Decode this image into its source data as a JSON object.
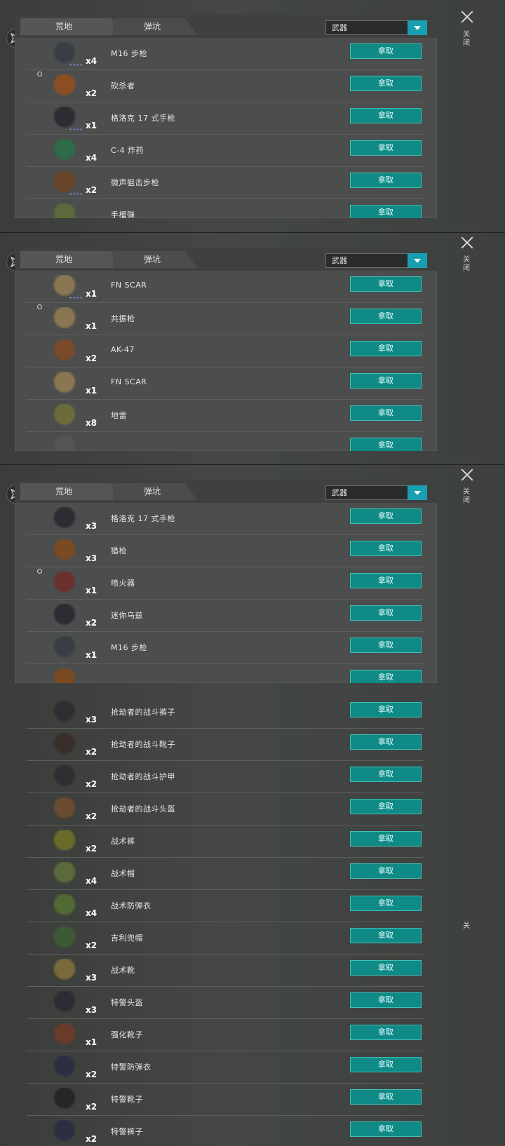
{
  "common": {
    "tab_wasteland": "荒地",
    "tab_crater": "弹坑",
    "filter_value": "武器",
    "take_label": "拿取",
    "close_label": "关闭",
    "close_label_partial": "关"
  },
  "colors": {
    "accent": "#1a9fb1",
    "take_button": "#0f8a86",
    "panel": "#4b4e4c"
  },
  "panel1": {
    "items": [
      {
        "name": "M16 步枪",
        "qty": "x4",
        "icon": "rifle-icon",
        "color": "#3a3d44",
        "dots": true,
        "badge": false
      },
      {
        "name": "砍杀者",
        "qty": "x2",
        "icon": "rocket-launcher-icon",
        "color": "#8b4e22",
        "dots": false,
        "badge": true
      },
      {
        "name": "格洛克 17 式手枪",
        "qty": "x1",
        "icon": "pistol-icon",
        "color": "#2b2d33",
        "dots": true,
        "badge": false
      },
      {
        "name": "C-4 炸药",
        "qty": "x4",
        "icon": "explosive-icon",
        "color": "#2e6b4a",
        "dots": false,
        "badge": false
      },
      {
        "name": "微声狙击步枪",
        "qty": "x2",
        "icon": "sniper-rifle-icon",
        "color": "#6a4426",
        "dots": true,
        "badge": false
      },
      {
        "name": "手榴弹",
        "qty": "",
        "icon": "grenade-icon",
        "color": "#5b6a3a",
        "dots": false,
        "badge": false
      }
    ]
  },
  "panel2": {
    "items": [
      {
        "name": "FN SCAR",
        "qty": "x1",
        "icon": "assault-rifle-icon",
        "color": "#8a7650",
        "dots": true,
        "badge": false
      },
      {
        "name": "共振枪",
        "qty": "x1",
        "icon": "resonance-gun-icon",
        "color": "#8a7650",
        "dots": false,
        "badge": true
      },
      {
        "name": "AK-47",
        "qty": "x2",
        "icon": "ak-rifle-icon",
        "color": "#7a4a2a",
        "dots": false,
        "badge": false
      },
      {
        "name": "FN SCAR",
        "qty": "x1",
        "icon": "assault-rifle-icon",
        "color": "#8a7650",
        "dots": false,
        "badge": false
      },
      {
        "name": "地雷",
        "qty": "x8",
        "icon": "landmine-icon",
        "color": "#6b6b3c",
        "dots": false,
        "badge": false
      },
      {
        "name": "",
        "qty": "",
        "icon": "weapon-icon",
        "color": "#555",
        "dots": false,
        "badge": false
      }
    ]
  },
  "panel3": {
    "items": [
      {
        "name": "格洛克 17 式手枪",
        "qty": "x3",
        "icon": "pistol-icon",
        "color": "#2b2d33",
        "dots": false,
        "badge": false
      },
      {
        "name": "猎枪",
        "qty": "x3",
        "icon": "shotgun-icon",
        "color": "#7a4a22",
        "dots": false,
        "badge": false
      },
      {
        "name": "喷火器",
        "qty": "x1",
        "icon": "flamethrower-icon",
        "color": "#6a3030",
        "dots": false,
        "badge": true
      },
      {
        "name": "迷你乌兹",
        "qty": "x2",
        "icon": "smg-icon",
        "color": "#2b2d33",
        "dots": false,
        "badge": false
      },
      {
        "name": "M16 步枪",
        "qty": "x1",
        "icon": "rifle-icon",
        "color": "#3a3d44",
        "dots": false,
        "badge": false
      },
      {
        "name": "",
        "qty": "",
        "icon": "weapon-icon",
        "color": "#7a4a22",
        "dots": false,
        "badge": false
      }
    ]
  },
  "panel4": {
    "items": [
      {
        "name": "抢劫者的战斗裤子",
        "qty": "x3",
        "icon": "pants-icon",
        "color": "#2e2f33"
      },
      {
        "name": "抢劫者的战斗靴子",
        "qty": "x2",
        "icon": "boots-icon",
        "color": "#3a2e2a"
      },
      {
        "name": "抢劫者的战斗护甲",
        "qty": "x2",
        "icon": "armor-vest-icon",
        "color": "#2e2f33"
      },
      {
        "name": "抢劫者的战斗头盔",
        "qty": "x2",
        "icon": "helmet-icon",
        "color": "#6a4a30"
      },
      {
        "name": "战术裤",
        "qty": "x2",
        "icon": "pants-icon",
        "color": "#6a6a2a"
      },
      {
        "name": "战术帽",
        "qty": "x4",
        "icon": "cap-icon",
        "color": "#5b6a3a"
      },
      {
        "name": "战术防弹衣",
        "qty": "x4",
        "icon": "vest-icon",
        "color": "#4f6a33"
      },
      {
        "name": "吉利兜帽",
        "qty": "x2",
        "icon": "hood-icon",
        "color": "#3e5a35"
      },
      {
        "name": "战术靴",
        "qty": "x3",
        "icon": "boots-icon",
        "color": "#7a6a3a"
      },
      {
        "name": "特警头盔",
        "qty": "x3",
        "icon": "helmet-icon",
        "color": "#2b2d33"
      },
      {
        "name": "强化靴子",
        "qty": "x1",
        "icon": "boots-icon",
        "color": "#6a3a2a"
      },
      {
        "name": "特警防弹衣",
        "qty": "x2",
        "icon": "vest-icon",
        "color": "#2b3040"
      },
      {
        "name": "特警靴子",
        "qty": "x2",
        "icon": "boots-icon",
        "color": "#25262a"
      },
      {
        "name": "特警裤子",
        "qty": "x2",
        "icon": "pants-icon",
        "color": "#2b3040"
      }
    ]
  }
}
